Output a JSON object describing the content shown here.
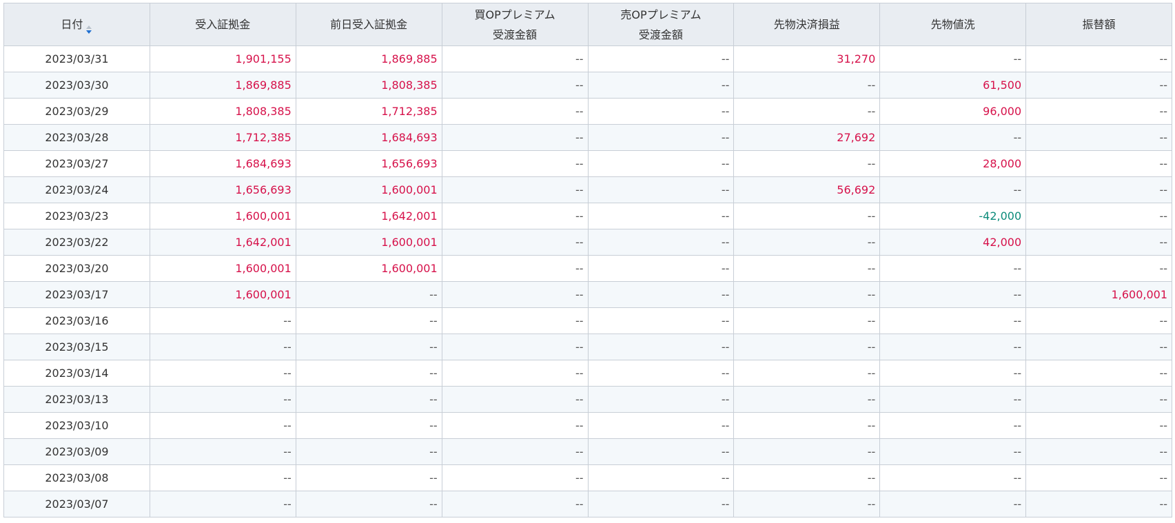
{
  "table": {
    "headers": [
      {
        "line1": "日付",
        "line2": ""
      },
      {
        "line1": "受入証拠金",
        "line2": ""
      },
      {
        "line1": "前日受入証拠金",
        "line2": ""
      },
      {
        "line1": "買OPプレミアム",
        "line2": "受渡金額"
      },
      {
        "line1": "売OPプレミアム",
        "line2": "受渡金額"
      },
      {
        "line1": "先物決済損益",
        "line2": ""
      },
      {
        "line1": "先物値洗",
        "line2": ""
      },
      {
        "line1": "振替額",
        "line2": ""
      }
    ],
    "sort_icon": "sort-desc-icon",
    "colors": {
      "positive": "#d6114a",
      "negative": "#0c8b7a",
      "header_bg": "#e9edf2",
      "sort_up": "#b9c2cc",
      "sort_down": "#1f6fd1"
    },
    "rows": [
      [
        "2023/03/31",
        "1,901,155",
        "1,869,885",
        "--",
        "--",
        "31,270",
        "--",
        "--"
      ],
      [
        "2023/03/30",
        "1,869,885",
        "1,808,385",
        "--",
        "--",
        "--",
        "61,500",
        "--"
      ],
      [
        "2023/03/29",
        "1,808,385",
        "1,712,385",
        "--",
        "--",
        "--",
        "96,000",
        "--"
      ],
      [
        "2023/03/28",
        "1,712,385",
        "1,684,693",
        "--",
        "--",
        "27,692",
        "--",
        "--"
      ],
      [
        "2023/03/27",
        "1,684,693",
        "1,656,693",
        "--",
        "--",
        "--",
        "28,000",
        "--"
      ],
      [
        "2023/03/24",
        "1,656,693",
        "1,600,001",
        "--",
        "--",
        "56,692",
        "--",
        "--"
      ],
      [
        "2023/03/23",
        "1,600,001",
        "1,642,001",
        "--",
        "--",
        "--",
        "-42,000",
        "--"
      ],
      [
        "2023/03/22",
        "1,642,001",
        "1,600,001",
        "--",
        "--",
        "--",
        "42,000",
        "--"
      ],
      [
        "2023/03/20",
        "1,600,001",
        "1,600,001",
        "--",
        "--",
        "--",
        "--",
        "--"
      ],
      [
        "2023/03/17",
        "1,600,001",
        "--",
        "--",
        "--",
        "--",
        "--",
        "1,600,001"
      ],
      [
        "2023/03/16",
        "--",
        "--",
        "--",
        "--",
        "--",
        "--",
        "--"
      ],
      [
        "2023/03/15",
        "--",
        "--",
        "--",
        "--",
        "--",
        "--",
        "--"
      ],
      [
        "2023/03/14",
        "--",
        "--",
        "--",
        "--",
        "--",
        "--",
        "--"
      ],
      [
        "2023/03/13",
        "--",
        "--",
        "--",
        "--",
        "--",
        "--",
        "--"
      ],
      [
        "2023/03/10",
        "--",
        "--",
        "--",
        "--",
        "--",
        "--",
        "--"
      ],
      [
        "2023/03/09",
        "--",
        "--",
        "--",
        "--",
        "--",
        "--",
        "--"
      ],
      [
        "2023/03/08",
        "--",
        "--",
        "--",
        "--",
        "--",
        "--",
        "--"
      ],
      [
        "2023/03/07",
        "--",
        "--",
        "--",
        "--",
        "--",
        "--",
        "--"
      ]
    ]
  }
}
